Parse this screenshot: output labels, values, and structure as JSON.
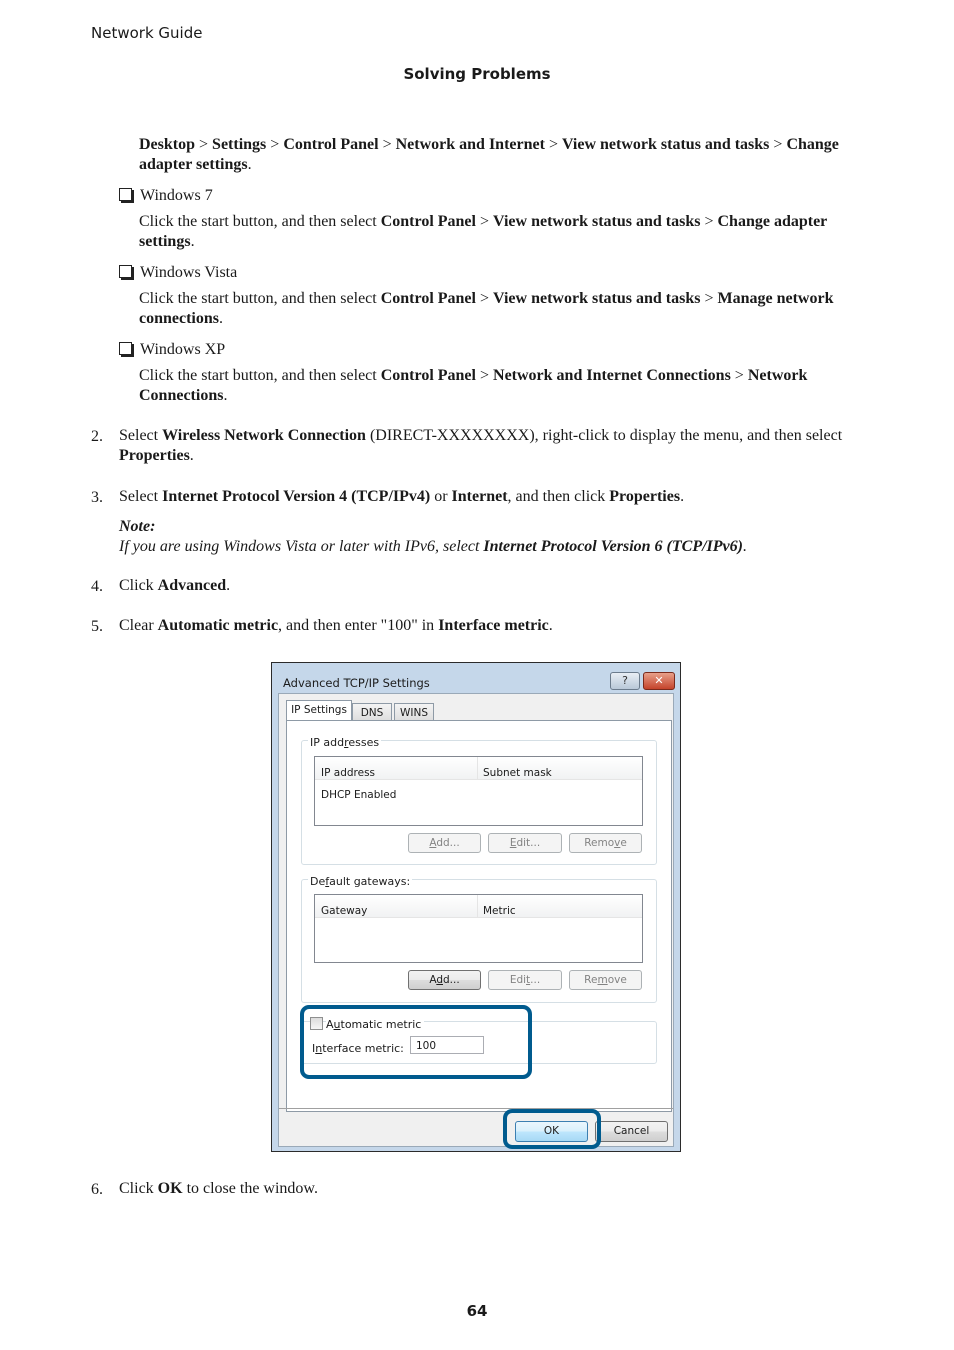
{
  "header": {
    "running_title": "Network Guide",
    "section_title": "Solving Problems"
  },
  "intro_path": {
    "parts": [
      "Desktop",
      " > ",
      "Settings",
      " > ",
      "Control Panel",
      " > ",
      "Network and Internet",
      " > ",
      "View network status and tasks",
      " > ",
      "Change adapter settings",
      "."
    ]
  },
  "os_items": [
    {
      "label": "Windows 7",
      "text_prefix": "Click the start button, and then select ",
      "path": [
        "Control Panel",
        "View network status and tasks",
        "Change adapter settings"
      ]
    },
    {
      "label": "Windows Vista",
      "text_prefix": "Click the start button, and then select ",
      "path": [
        "Control Panel",
        "View network status and tasks",
        "Manage network connections"
      ]
    },
    {
      "label": "Windows XP",
      "text_prefix": "Click the start button, and then select ",
      "path": [
        "Control Panel",
        "Network and Internet Connections",
        "Network Connections"
      ]
    }
  ],
  "separator": " > ",
  "steps": [
    {
      "num": "2.",
      "parts": [
        {
          "t": "Select "
        },
        {
          "b": "Wireless Network Connection"
        },
        {
          "t": " (DIRECT-XXXXXXXX), right-click to display the menu, and then select "
        },
        {
          "b": "Properties"
        },
        {
          "t": "."
        }
      ]
    },
    {
      "num": "3.",
      "parts": [
        {
          "t": "Select "
        },
        {
          "b": "Internet Protocol Version 4 (TCP/IPv4)"
        },
        {
          "t": " or "
        },
        {
          "b": "Internet"
        },
        {
          "t": ", and then click "
        },
        {
          "b": "Properties"
        },
        {
          "t": "."
        }
      ],
      "note_label": "Note:",
      "note_parts": [
        {
          "t": "If you are using Windows Vista or later with IPv6, select "
        },
        {
          "b": "Internet Protocol Version 6 (TCP/IPv6)"
        },
        {
          "t": "."
        }
      ]
    },
    {
      "num": "4.",
      "parts": [
        {
          "t": "Click "
        },
        {
          "b": "Advanced"
        },
        {
          "t": "."
        }
      ]
    },
    {
      "num": "5.",
      "parts": [
        {
          "t": "Clear "
        },
        {
          "b": "Automatic metric"
        },
        {
          "t": ", and then enter \"100\" in "
        },
        {
          "b": "Interface metric"
        },
        {
          "t": "."
        }
      ]
    },
    {
      "num": "6.",
      "parts": [
        {
          "t": "Click "
        },
        {
          "b": "OK"
        },
        {
          "t": " to close the window."
        }
      ]
    }
  ],
  "dialog": {
    "title": "Advanced TCP/IP Settings",
    "help_glyph": "?",
    "close_glyph": "✕",
    "tabs": [
      {
        "label": "IP Settings",
        "active": true
      },
      {
        "label": "DNS",
        "active": false
      },
      {
        "label": "WINS",
        "active": false
      }
    ],
    "ip_group": {
      "label_pre": "IP add",
      "label_u": "r",
      "label_post": "esses",
      "columns": [
        "IP address",
        "Subnet mask"
      ],
      "rows": [
        "DHCP Enabled"
      ],
      "buttons": [
        {
          "u": "A",
          "rest": "dd...",
          "enabled": false
        },
        {
          "u": "E",
          "rest": "dit...",
          "enabled": false
        },
        {
          "pre": "Remo",
          "u": "v",
          "rest": "e",
          "enabled": false
        }
      ]
    },
    "gw_group": {
      "label_pre": "De",
      "label_u": "f",
      "label_post": "ault gateways:",
      "columns": [
        "Gateway",
        "Metric"
      ],
      "buttons": [
        {
          "pre": "A",
          "u": "d",
          "rest": "d...",
          "enabled": true
        },
        {
          "pre": "Edi",
          "u": "t",
          "rest": "...",
          "enabled": false
        },
        {
          "pre": "Re",
          "u": "m",
          "rest": "ove",
          "enabled": false
        }
      ]
    },
    "metric": {
      "auto_checked": false,
      "auto_label_pre": "A",
      "auto_label_u": "u",
      "auto_label_post": "tomatic metric",
      "iface_label_pre": "I",
      "iface_label_u": "n",
      "iface_label_post": "terface metric:",
      "iface_value": "100"
    },
    "ok_label": "OK",
    "cancel_label": "Cancel",
    "highlight_color": "#005b8e"
  },
  "footer": {
    "page_number": "64"
  }
}
